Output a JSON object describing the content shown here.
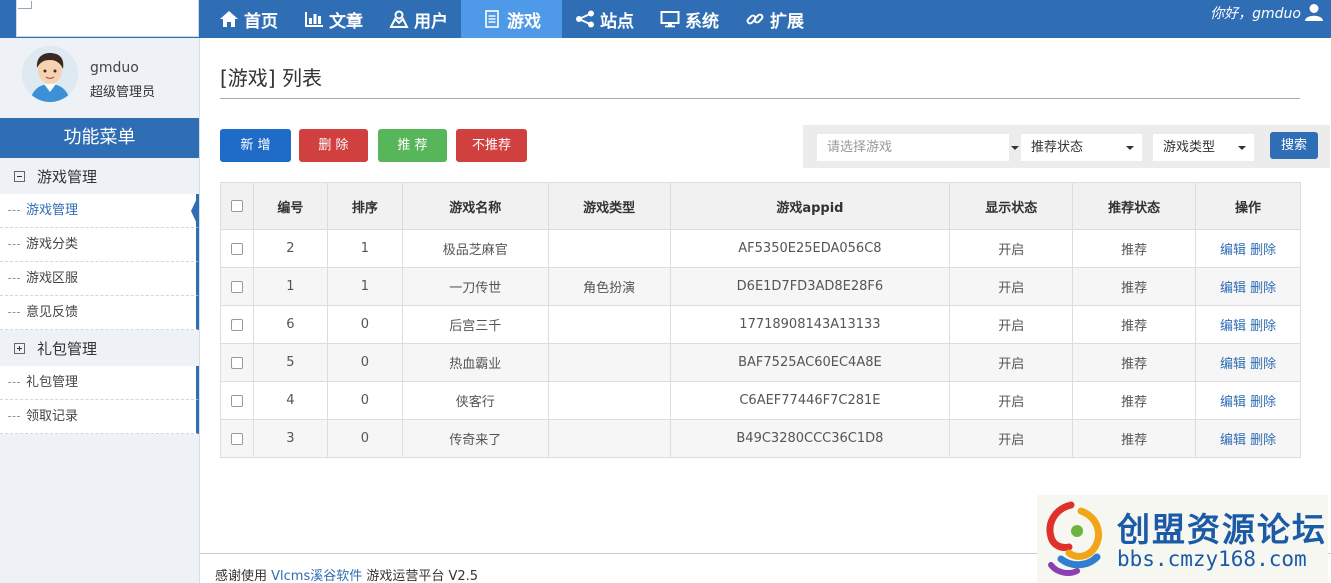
{
  "nav": {
    "items": [
      {
        "label": "首页",
        "icon": "home-icon"
      },
      {
        "label": "文章",
        "icon": "bar-chart-icon"
      },
      {
        "label": "用户",
        "icon": "user-icon"
      },
      {
        "label": "游戏",
        "icon": "document-icon",
        "active": true
      },
      {
        "label": "站点",
        "icon": "share-icon"
      },
      {
        "label": "系统",
        "icon": "monitor-icon"
      },
      {
        "label": "扩展",
        "icon": "link-icon"
      }
    ],
    "greeting": "你好，gmduo",
    "accent_color": "#2f6db4",
    "active_color": "#4e9ae8"
  },
  "sidebar": {
    "username": "gmduo",
    "role": "超级管理员",
    "menu_title": "功能菜单",
    "groups": [
      {
        "label": "游戏管理",
        "expanded": true,
        "items": [
          "游戏管理",
          "游戏分类",
          "游戏区服",
          "意见反馈"
        ]
      },
      {
        "label": "礼包管理",
        "expanded": false,
        "items": [
          "礼包管理",
          "领取记录"
        ]
      }
    ]
  },
  "main": {
    "title": "[游戏] 列表",
    "buttons": {
      "new": "新 增",
      "delete": "删 除",
      "recommend": "推 荐",
      "unrecommend": "不推荐"
    },
    "filters": {
      "game_placeholder": "请选择游戏",
      "recommend_status": "推荐状态",
      "game_type": "游戏类型",
      "search": "搜索"
    },
    "table": {
      "headers": [
        "编号",
        "排序",
        "游戏名称",
        "游戏类型",
        "游戏appid",
        "显示状态",
        "推荐状态",
        "操作"
      ],
      "rows": [
        {
          "id": "2",
          "sort": "1",
          "name": "极品芝麻官",
          "type": "",
          "appid": "AF5350E25EDA056C8",
          "show": "开启",
          "rec": "推荐"
        },
        {
          "id": "1",
          "sort": "1",
          "name": "一刀传世",
          "type": "角色扮演",
          "appid": "D6E1D7FD3AD8E28F6",
          "show": "开启",
          "rec": "推荐"
        },
        {
          "id": "6",
          "sort": "0",
          "name": "后宫三千",
          "type": "",
          "appid": "17718908143A13133",
          "show": "开启",
          "rec": "推荐"
        },
        {
          "id": "5",
          "sort": "0",
          "name": "热血霸业",
          "type": "",
          "appid": "BAF7525AC60EC4A8E",
          "show": "开启",
          "rec": "推荐"
        },
        {
          "id": "4",
          "sort": "0",
          "name": "侠客行",
          "type": "",
          "appid": "C6AEF77446F7C281E",
          "show": "开启",
          "rec": "推荐"
        },
        {
          "id": "3",
          "sort": "0",
          "name": "传奇来了",
          "type": "",
          "appid": "B49C3280CCC36C1D8",
          "show": "开启",
          "rec": "推荐"
        }
      ],
      "edit_label": "编辑",
      "delete_label": "删除"
    }
  },
  "footer": {
    "prefix": "感谢使用 ",
    "link": "Vlcms溪谷软件",
    "suffix": " 游戏运营平台 V2.5"
  },
  "watermark": {
    "title": "创盟资源论坛",
    "url": "bbs.cmzy168.com"
  }
}
